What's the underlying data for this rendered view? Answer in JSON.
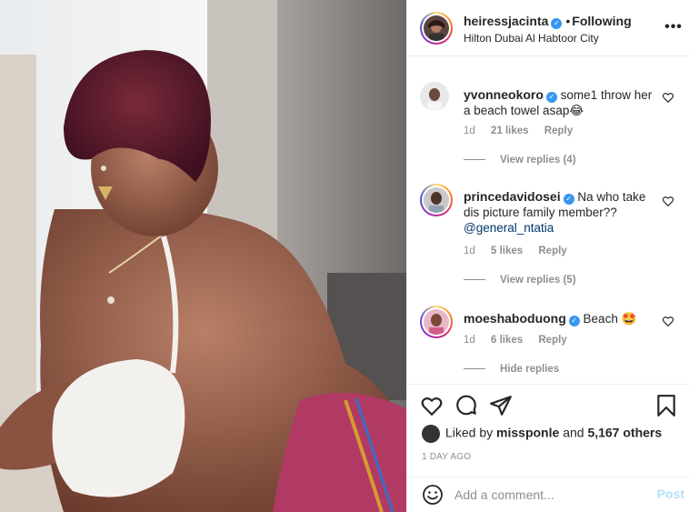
{
  "post": {
    "username": "heiressjacinta",
    "dot": "•",
    "follow_status": "Following",
    "location": "Hilton Dubai Al Habtoor City",
    "more_icon": "more-horizontal-icon"
  },
  "comments": [
    {
      "username": "yvonneokoro",
      "text": "some1 throw her a beach towel asap😂",
      "time": "1d",
      "likes": "21 likes",
      "reply": "Reply",
      "view_replies": "View replies (4)"
    },
    {
      "username": "princedavidosei",
      "text": "Na who take dis picture family member??",
      "mention": "@general_ntatia",
      "time": "1d",
      "likes": "5 likes",
      "reply": "Reply",
      "view_replies": "View replies (5)"
    },
    {
      "username": "moeshaboduong",
      "text": "Beach 🤩",
      "time": "1d",
      "likes": "6 likes",
      "reply": "Reply",
      "view_replies": "Hide replies"
    }
  ],
  "likes": {
    "prefix": "Liked by",
    "user": "missponle",
    "connector": "and",
    "others": "5,167 others"
  },
  "time_ago": "1 DAY AGO",
  "add_comment": {
    "placeholder": "Add a comment...",
    "post_label": "Post"
  },
  "colors": {
    "verified": "#3897f0",
    "secondary_text": "#8e8e8e",
    "post_button": "#b2dffc",
    "mention": "#00376b"
  }
}
